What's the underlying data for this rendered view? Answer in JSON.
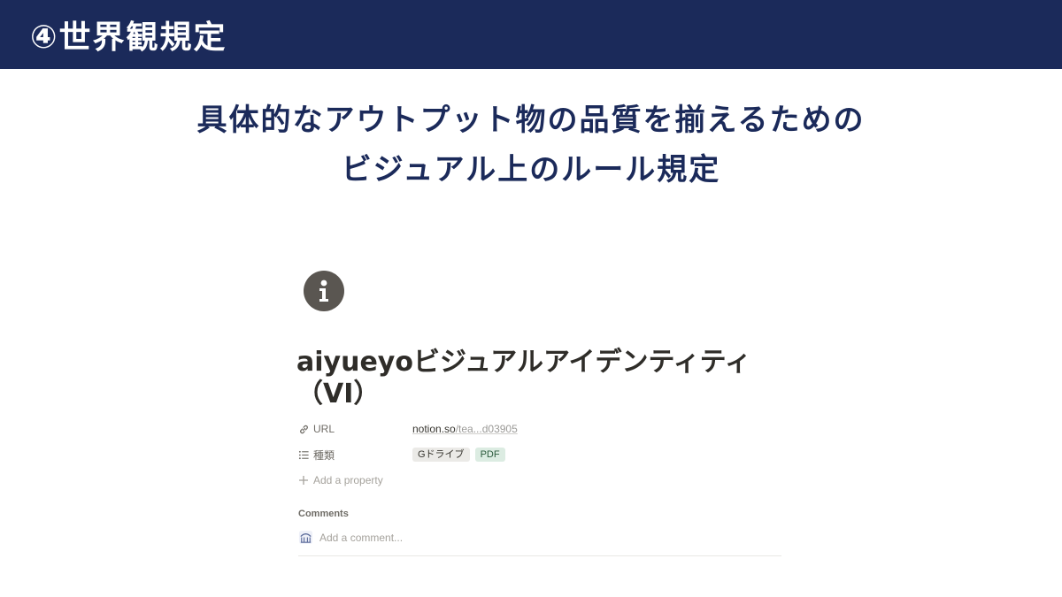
{
  "banner": {
    "title": "④世界観規定"
  },
  "subtitle": {
    "line1": "具体的なアウトプット物の品質を揃えるための",
    "line2": "ビジュアル上のルール規定"
  },
  "page": {
    "icon": "info-icon",
    "title": "aiyueyoビジュアルアイデンティティ（VI）"
  },
  "properties": {
    "url": {
      "label": "URL",
      "icon": "link-icon",
      "value_main": "notion.so",
      "value_rest": "/tea...d03905"
    },
    "type": {
      "label": "種類",
      "icon": "list-icon",
      "tags": [
        "Gドライブ",
        "PDF"
      ]
    },
    "add_label": "Add a property"
  },
  "comments": {
    "heading": "Comments",
    "placeholder": "Add a comment..."
  },
  "colors": {
    "banner": "#1b2a5a",
    "tag_gray": "#ebeae7",
    "tag_green": "#dcece2"
  }
}
